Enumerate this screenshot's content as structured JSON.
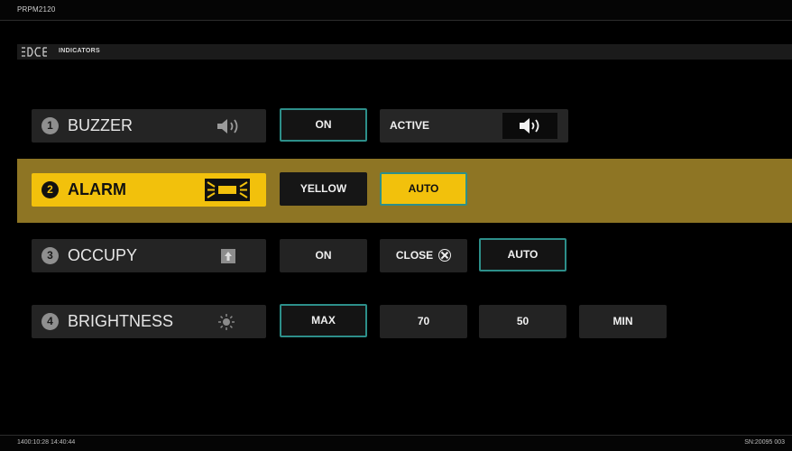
{
  "header": {
    "model": "PRPM2120"
  },
  "section": {
    "title": "INDICATORS"
  },
  "rows": [
    {
      "number": "1",
      "label": "BUZZER",
      "icon": "speaker-icon",
      "buttons": {
        "on": "ON"
      },
      "status": {
        "text": "ACTIVE",
        "icon": "speaker-icon"
      }
    },
    {
      "number": "2",
      "label": "ALARM",
      "icon": "alarm-light-icon",
      "buttons": {
        "yellow": "YELLOW",
        "auto": "AUTO"
      }
    },
    {
      "number": "3",
      "label": "OCCUPY",
      "icon": "occupy-icon",
      "buttons": {
        "on": "ON",
        "close": "CLOSE",
        "auto": "AUTO"
      }
    },
    {
      "number": "4",
      "label": "BRIGHTNESS",
      "icon": "brightness-icon",
      "buttons": {
        "max": "MAX",
        "v70": "70",
        "v50": "50",
        "min": "MIN"
      }
    }
  ],
  "footer": {
    "datetime": "1400:10:28 14:40:44",
    "serial": "SN:20095 003"
  },
  "colors": {
    "accent_yellow": "#f2c10c",
    "highlight_row": "#8e7524",
    "selected_border": "#2d8f8a"
  }
}
